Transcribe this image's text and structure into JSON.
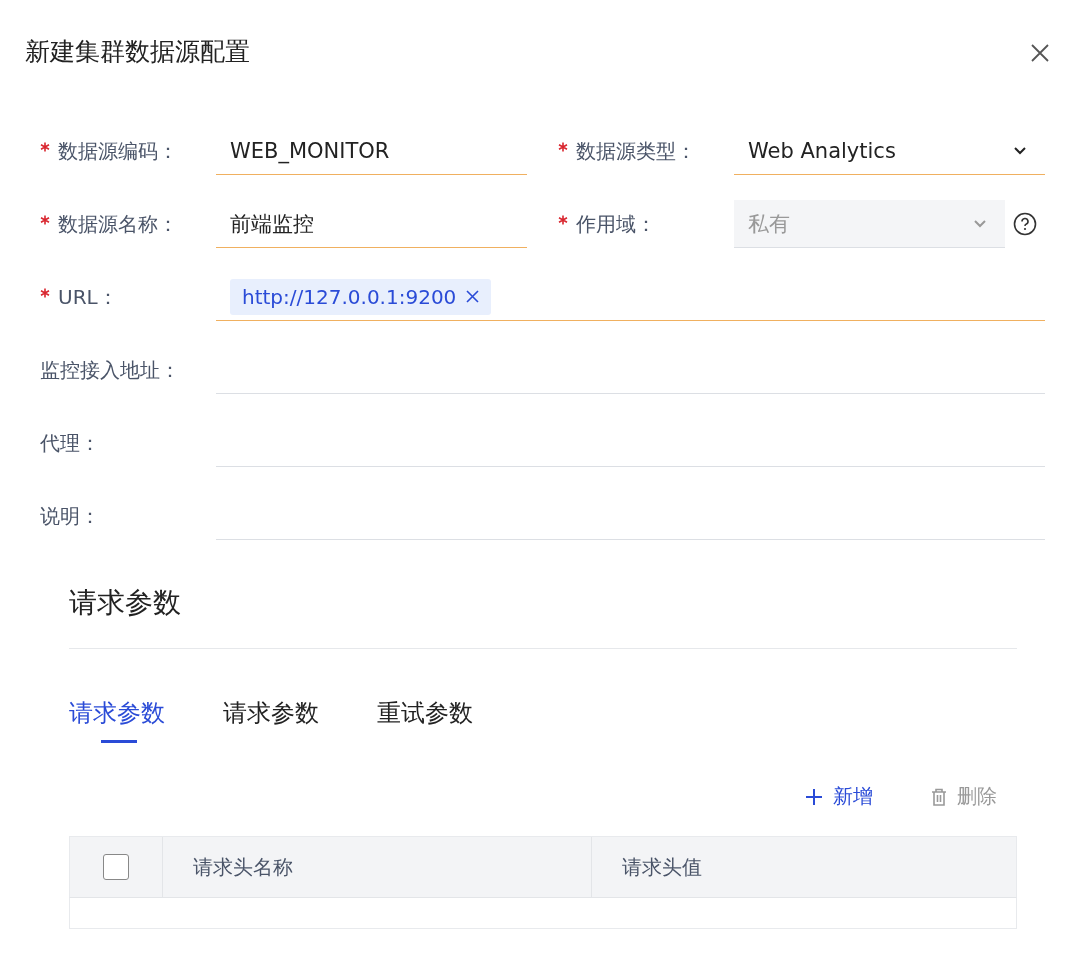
{
  "dialog": {
    "title": "新建集群数据源配置"
  },
  "form": {
    "rows": [
      [
        {
          "label": "数据源编码：",
          "required": true,
          "kind": "text",
          "value": "WEB_MONITOR",
          "highlighted": true
        },
        {
          "label": "数据源类型：",
          "required": true,
          "kind": "select",
          "value": "Web Analytics",
          "highlighted": true,
          "disabled": false
        }
      ],
      [
        {
          "label": "数据源名称：",
          "required": true,
          "kind": "text",
          "value": "前端监控",
          "highlighted": true
        },
        {
          "label": "作用域：",
          "required": true,
          "kind": "select",
          "value": "私有",
          "highlighted": false,
          "disabled": true,
          "help": true
        }
      ],
      [
        {
          "label": "URL：",
          "required": true,
          "kind": "tags",
          "tags": [
            "http://127.0.0.1:9200"
          ],
          "highlighted": true
        }
      ],
      [
        {
          "label": "监控接入地址：",
          "required": false,
          "kind": "text",
          "highlighted": false
        }
      ],
      [
        {
          "label": "代理：",
          "required": false,
          "kind": "text",
          "highlighted": false
        }
      ],
      [
        {
          "label": "说明：",
          "required": false,
          "kind": "text",
          "highlighted": false
        }
      ]
    ]
  },
  "section": {
    "title": "请求参数",
    "tabs": [
      {
        "label": "请求参数",
        "selected": true
      },
      {
        "label": "请求参数",
        "selected": false
      },
      {
        "label": "重试参数",
        "selected": false
      }
    ],
    "actions": [
      {
        "kind": "add",
        "label": "新增",
        "disabled": false
      },
      {
        "kind": "delete",
        "label": "删除",
        "disabled": true
      }
    ],
    "table": {
      "select_all_checked": false,
      "columns": [
        "请求头名称",
        "请求头值"
      ]
    }
  }
}
